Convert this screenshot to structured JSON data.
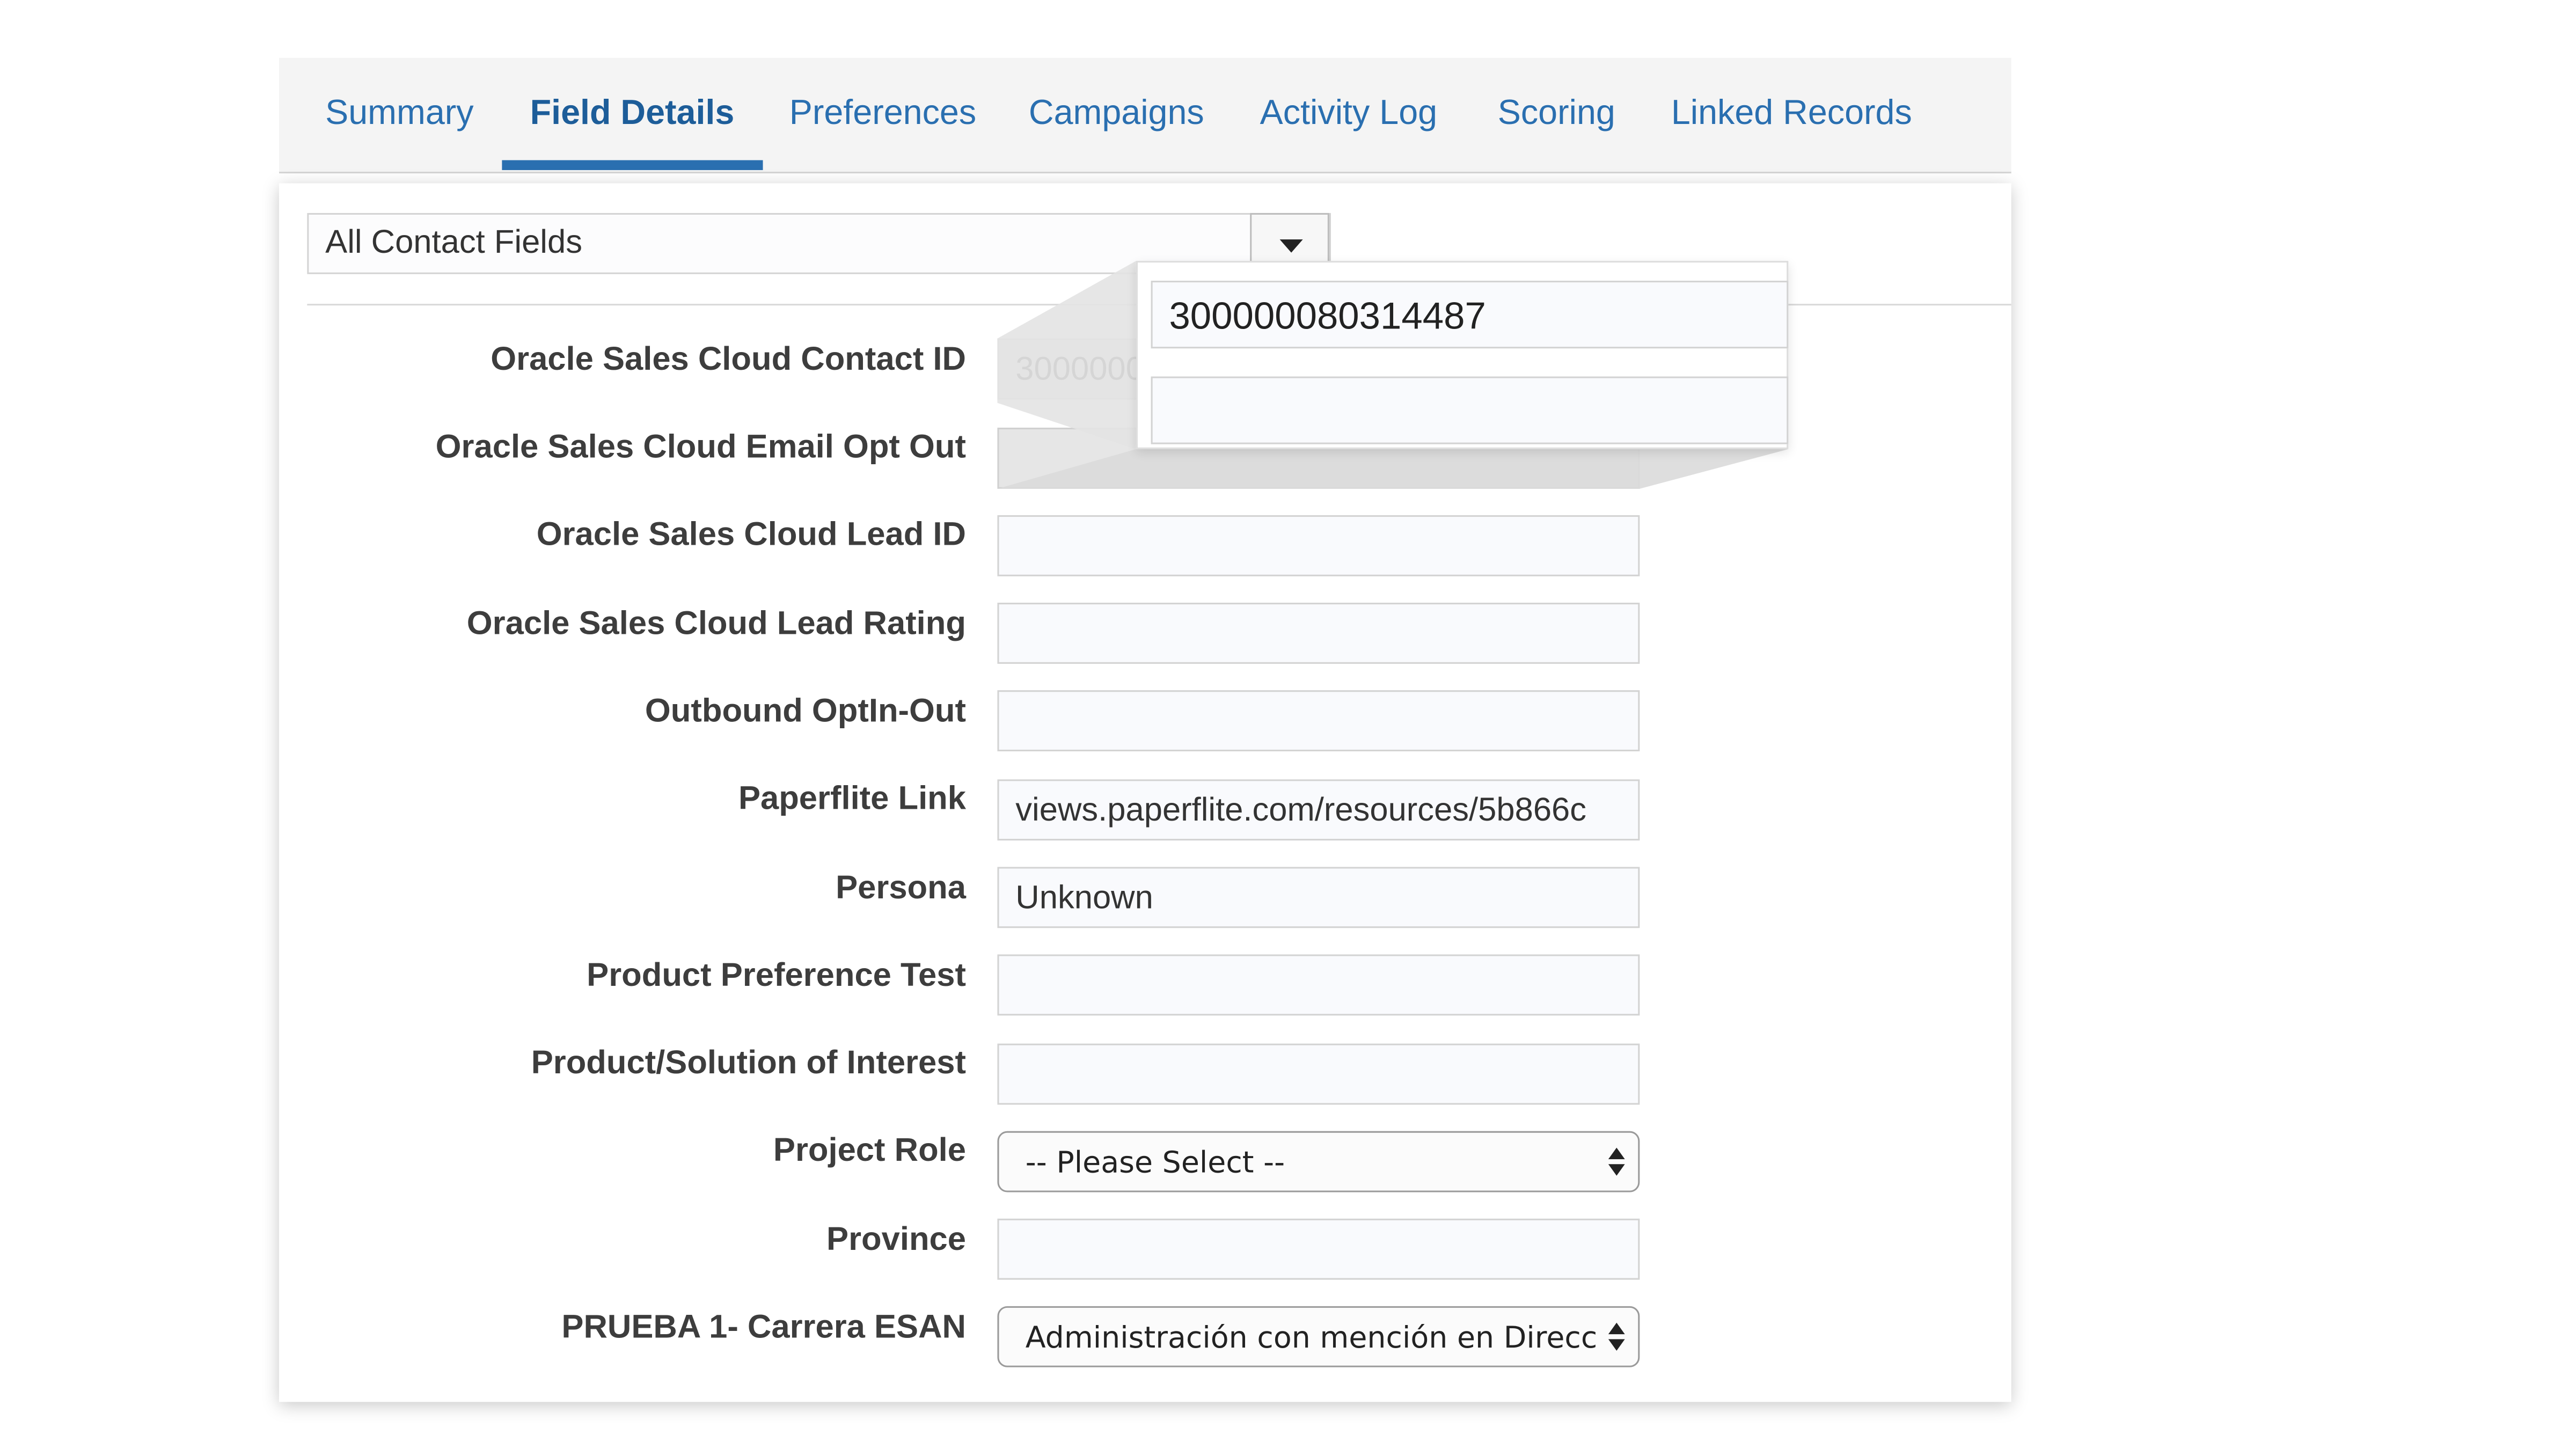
{
  "tabs": [
    {
      "label": "Summary",
      "active": false
    },
    {
      "label": "Field Details",
      "active": true
    },
    {
      "label": "Preferences",
      "active": false
    },
    {
      "label": "Campaigns",
      "active": false
    },
    {
      "label": "Activity Log",
      "active": false
    },
    {
      "label": "Scoring",
      "active": false
    },
    {
      "label": "Linked Records",
      "active": false
    }
  ],
  "filter": {
    "selected": "All Contact Fields",
    "dropdown_icon": "caret-down-icon"
  },
  "fields": [
    {
      "label": "Oracle Sales Cloud Contact ID",
      "value": "30000008",
      "type": "readonly"
    },
    {
      "label": "Oracle Sales Cloud Email Opt Out",
      "value": "",
      "type": "readonly"
    },
    {
      "label": "Oracle Sales Cloud Lead ID",
      "value": "",
      "type": "text"
    },
    {
      "label": "Oracle Sales Cloud Lead Rating",
      "value": "",
      "type": "text"
    },
    {
      "label": "Outbound OptIn-Out",
      "value": "",
      "type": "text"
    },
    {
      "label": "Paperflite Link",
      "value": "views.paperflite.com/resources/5b866c",
      "type": "text"
    },
    {
      "label": "Persona",
      "value": "Unknown",
      "type": "text"
    },
    {
      "label": "Product Preference Test",
      "value": "",
      "type": "text"
    },
    {
      "label": "Product/Solution of Interest",
      "value": "",
      "type": "text"
    },
    {
      "label": "Project Role",
      "value": "-- Please Select --",
      "type": "select"
    },
    {
      "label": "Province",
      "value": "",
      "type": "text"
    },
    {
      "label": "PRUEBA 1- Carrera ESAN",
      "value": "Administración con mención en Direcci",
      "type": "select"
    }
  ],
  "zoom": {
    "contact_id": "300000080314487",
    "email_opt_out": ""
  },
  "colors": {
    "accent": "#2a6fb0",
    "readonly_bg": "#e6e6e6"
  }
}
